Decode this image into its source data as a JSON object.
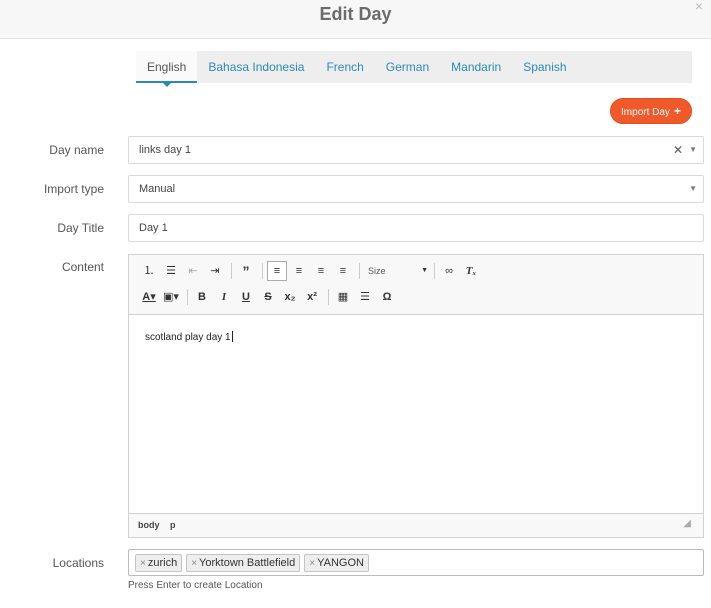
{
  "modal": {
    "title": "Edit Day",
    "close": "×"
  },
  "tabs": [
    "English",
    "Bahasa Indonesia",
    "French",
    "German",
    "Mandarin",
    "Spanish"
  ],
  "import_button": {
    "label": "Import Day",
    "icon": "+"
  },
  "form": {
    "day_name": {
      "label": "Day name",
      "value": "links day 1"
    },
    "import_type": {
      "label": "Import type",
      "value": "Manual"
    },
    "day_title": {
      "label": "Day Title",
      "value": "Day 1"
    },
    "content": {
      "label": "Content",
      "size_label": "Size",
      "text": "scotland play day 1",
      "status_path": [
        "body",
        "p"
      ]
    },
    "locations": {
      "label": "Locations",
      "tags": [
        "zurich",
        "Yorktown Battlefield",
        "YANGON"
      ],
      "hint": "Press Enter to create Location"
    }
  },
  "colors": {
    "accent": "#2a8ab8",
    "button": "#f05a2a"
  }
}
